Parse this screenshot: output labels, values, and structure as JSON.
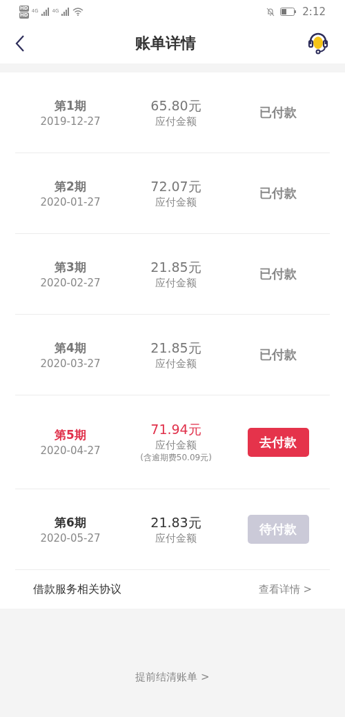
{
  "status_bar": {
    "sim_labels": [
      "HD",
      "HD"
    ],
    "networks": [
      "4G",
      "4G"
    ],
    "time": "2:12"
  },
  "header": {
    "title": "账单详情"
  },
  "installments": [
    {
      "period": "第1期",
      "date": "2019-12-27",
      "amount": "65.80元",
      "amount_label": "应付金额",
      "status": "已付款",
      "kind": "paid"
    },
    {
      "period": "第2期",
      "date": "2020-01-27",
      "amount": "72.07元",
      "amount_label": "应付金额",
      "status": "已付款",
      "kind": "paid"
    },
    {
      "period": "第3期",
      "date": "2020-02-27",
      "amount": "21.85元",
      "amount_label": "应付金额",
      "status": "已付款",
      "kind": "paid"
    },
    {
      "period": "第4期",
      "date": "2020-03-27",
      "amount": "21.85元",
      "amount_label": "应付金额",
      "status": "已付款",
      "kind": "paid"
    },
    {
      "period": "第5期",
      "date": "2020-04-27",
      "amount": "71.94元",
      "amount_label": "应付金额",
      "note": "(含逾期费50.09元)",
      "status": "去付款",
      "kind": "due"
    },
    {
      "period": "第6期",
      "date": "2020-05-27",
      "amount": "21.83元",
      "amount_label": "应付金额",
      "status": "待付款",
      "kind": "pending"
    }
  ],
  "agreement": {
    "label": "借款服务相关协议",
    "link": "查看详情 >"
  },
  "footer_link": "提前结清账单 >"
}
